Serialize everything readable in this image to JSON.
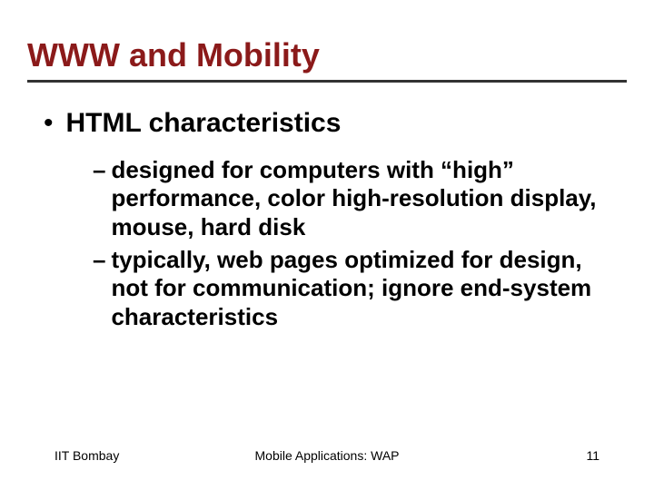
{
  "title": "WWW and Mobility",
  "mainBullet": "HTML characteristics",
  "subBullets": [
    "designed for computers with “high” performance, color high-resolution display, mouse, hard disk",
    "typically, web pages optimized for design, not for communication; ignore end-system characteristics"
  ],
  "footer": {
    "left": "IIT Bombay",
    "center": "Mobile Applications: WAP",
    "right": "11"
  }
}
